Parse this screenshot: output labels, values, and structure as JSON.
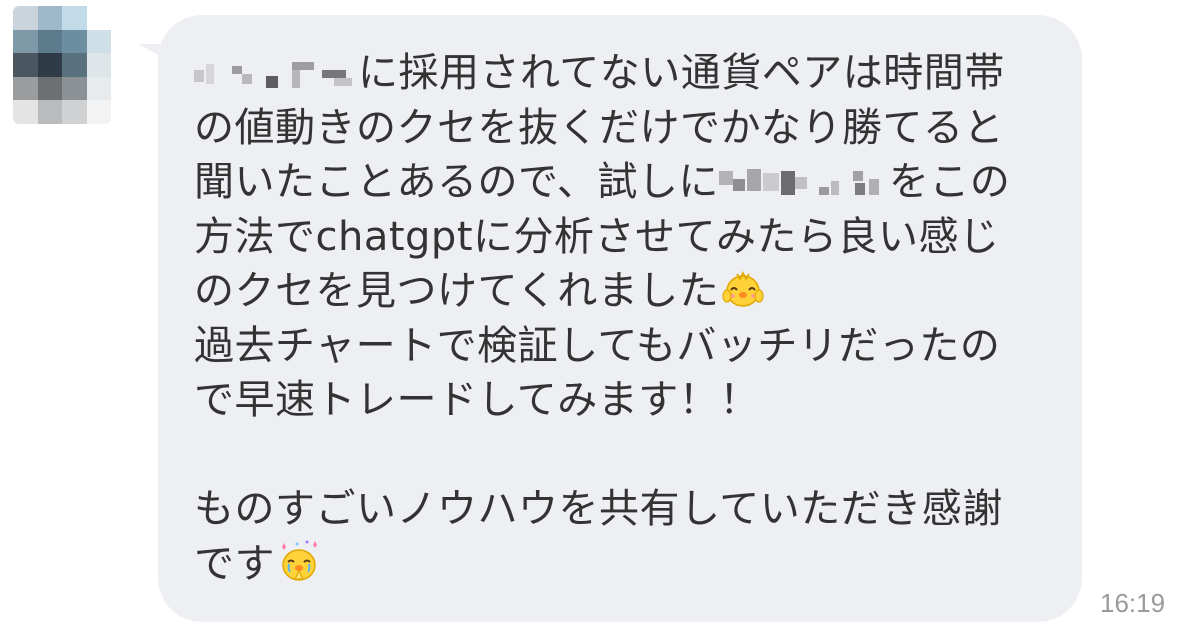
{
  "message": {
    "line1_after_blur": "に採用されてない通貨ペアは時間帯",
    "line2": "の値動きのクセを抜くだけでかなり勝てると",
    "line3_before_blur": "聞いたことあるので、試しに",
    "line3_after_blur": "をこの",
    "line4": "方法でchatgptに分析させてみたら良い感じ",
    "line5": "のクセを見つけてくれました",
    "line6": "過去チャートで検証してもバッチリだったの",
    "line7": "で早速トレードしてみます！！",
    "line8": "ものすごいノウハウを共有していただき感謝",
    "line9": "です"
  },
  "timestamp": "16:19",
  "emojis": {
    "happy": "chick-happy-emoji",
    "grateful": "chick-praying-emoji"
  }
}
